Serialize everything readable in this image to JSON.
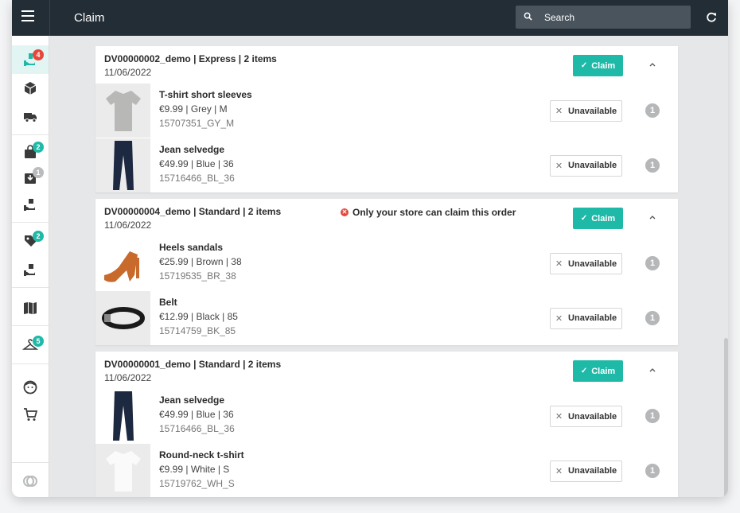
{
  "header": {
    "title": "Claim",
    "search_placeholder": "Search"
  },
  "sidebar": {
    "badges": {
      "claim": "4",
      "bag": "2",
      "download": "1",
      "tag": "2",
      "hanger": "5"
    }
  },
  "colors": {
    "accent": "#1fb9a8",
    "topbar": "#232d35",
    "alert": "#e6473b"
  },
  "orders": [
    {
      "title": "DV00000002_demo | Express | 2 items",
      "date": "11/06/2022",
      "claim_label": "Claim",
      "warning": "",
      "items": [
        {
          "name": "T-shirt short sleeves",
          "meta": "€9.99 | Grey | M",
          "sku": "15707351_GY_M",
          "unavailable_label": "Unavailable",
          "qty": "1",
          "thumb": "tshirt-grey"
        },
        {
          "name": "Jean selvedge",
          "meta": "€49.99 | Blue | 36",
          "sku": "15716466_BL_36",
          "unavailable_label": "Unavailable",
          "qty": "1",
          "thumb": "jeans"
        }
      ]
    },
    {
      "title": "DV00000004_demo | Standard | 2 items",
      "date": "11/06/2022",
      "claim_label": "Claim",
      "warning": "Only your store can claim this order",
      "items": [
        {
          "name": "Heels sandals",
          "meta": "€25.99 | Brown | 38",
          "sku": "15719535_BR_38",
          "unavailable_label": "Unavailable",
          "qty": "1",
          "thumb": "sandals"
        },
        {
          "name": "Belt",
          "meta": "€12.99 | Black | 85",
          "sku": "15714759_BK_85",
          "unavailable_label": "Unavailable",
          "qty": "1",
          "thumb": "belt"
        }
      ]
    },
    {
      "title": "DV00000001_demo | Standard | 2 items",
      "date": "11/06/2022",
      "claim_label": "Claim",
      "warning": "",
      "items": [
        {
          "name": "Jean selvedge",
          "meta": "€49.99 | Blue | 36",
          "sku": "15716466_BL_36",
          "unavailable_label": "Unavailable",
          "qty": "1",
          "thumb": "jeans"
        },
        {
          "name": "Round-neck t-shirt",
          "meta": "€9.99 | White | S",
          "sku": "15719762_WH_S",
          "unavailable_label": "Unavailable",
          "qty": "1",
          "thumb": "tshirt-white"
        }
      ]
    }
  ]
}
